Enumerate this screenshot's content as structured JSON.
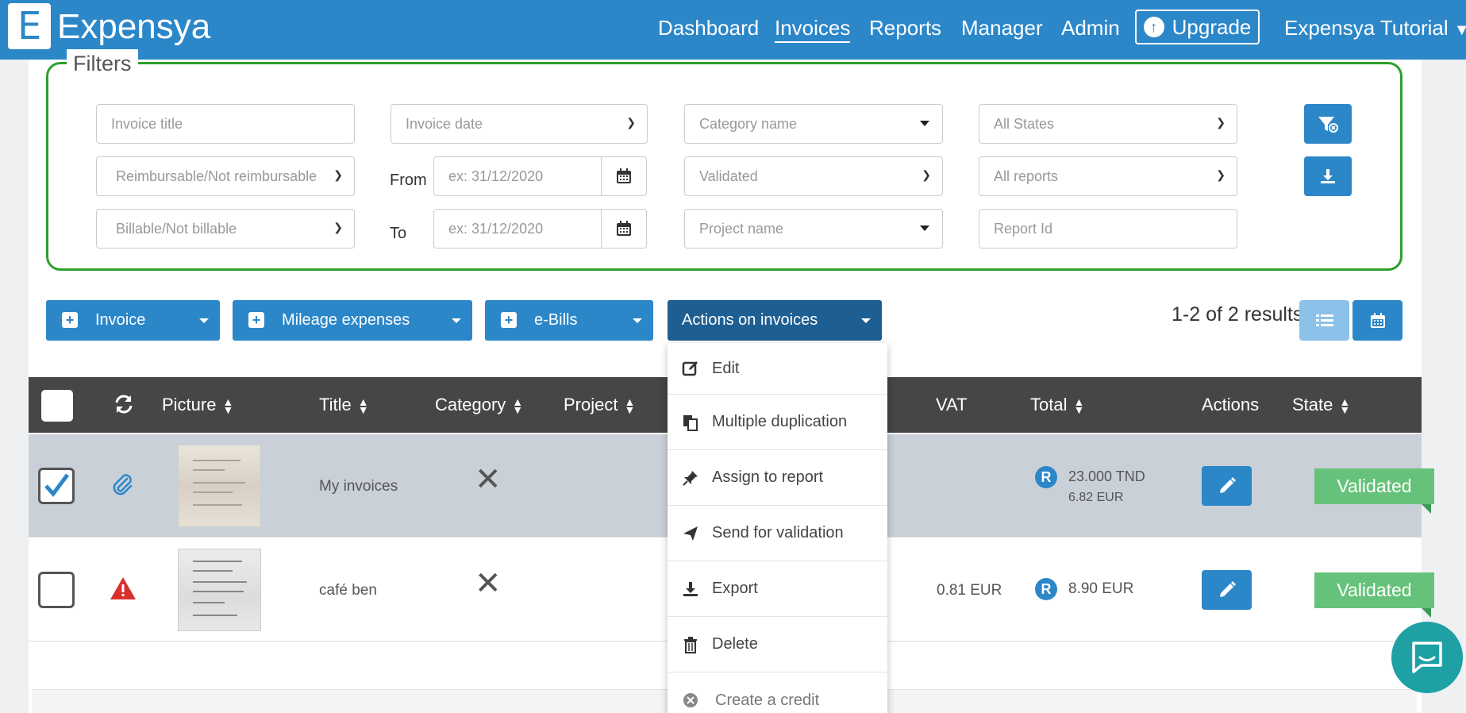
{
  "nav": {
    "brand": "Expensya",
    "logo_letter": "E",
    "items": [
      "Dashboard",
      "Invoices",
      "Reports",
      "Manager",
      "Admin"
    ],
    "upgrade": "Upgrade",
    "user": "Expensya Tutorial"
  },
  "filters": {
    "legend": "Filters",
    "invoice_title_placeholder": "Invoice title",
    "invoice_date": "Invoice date",
    "category_name": "Category name",
    "all_states": "All States",
    "reimbursable": "Reimbursable/Not reimbursable",
    "from_label": "From",
    "from_placeholder": "ex: 31/12/2020",
    "validated": "Validated",
    "all_reports": "All reports",
    "billable": "Billable/Not billable",
    "to_label": "To",
    "to_placeholder": "ex: 31/12/2020",
    "project_name": "Project name",
    "report_id_placeholder": "Report Id"
  },
  "actions": {
    "invoice": "Invoice",
    "mileage": "Mileage expenses",
    "ebills": "e-Bills",
    "on_invoices": "Actions on invoices",
    "results": "1-2 of 2 results"
  },
  "table": {
    "headers": [
      "Picture",
      "Title",
      "Category",
      "Project",
      "VAT",
      "Total",
      "Actions",
      "State"
    ],
    "rows": [
      {
        "title": "My invoices",
        "vat": "",
        "badge": "R",
        "total": "23.000 TND",
        "total_sub": "6.82 EUR",
        "state": "Validated",
        "checked": true
      },
      {
        "title": "café ben",
        "vat": "0.81 EUR",
        "badge": "R",
        "total": "8.90 EUR",
        "total_sub": "",
        "state": "Validated",
        "checked": false
      }
    ]
  },
  "dropdown": {
    "items": [
      "Edit",
      "Multiple duplication",
      "Assign to report",
      "Send for validation",
      "Export",
      "Delete",
      "Create a credit"
    ]
  },
  "colors": {
    "primary": "#2c87c9",
    "header_dark": "#464646",
    "validated_green": "#66c27a",
    "filters_border": "#2ca02c"
  }
}
